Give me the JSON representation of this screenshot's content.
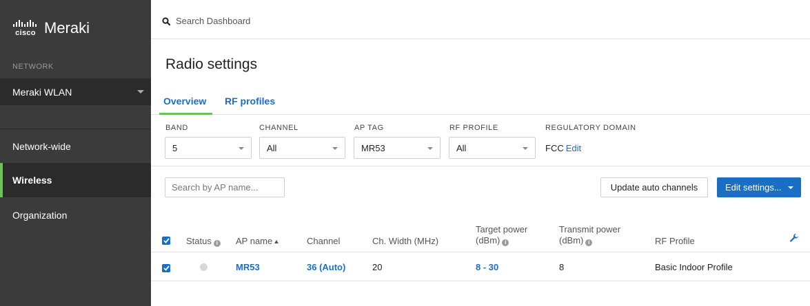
{
  "sidebar": {
    "logo_brand": "cisco",
    "logo_product": "Meraki",
    "section_label": "NETWORK",
    "network_selected": "Meraki WLAN",
    "items": [
      {
        "label": "Network-wide"
      },
      {
        "label": "Wireless"
      },
      {
        "label": "Organization"
      }
    ]
  },
  "topbar": {
    "search_placeholder": "Search Dashboard"
  },
  "page": {
    "title": "Radio settings",
    "tabs": [
      {
        "label": "Overview",
        "active": true
      },
      {
        "label": "RF profiles",
        "active": false
      }
    ]
  },
  "filters": {
    "band": {
      "label": "BAND",
      "value": "5"
    },
    "channel": {
      "label": "CHANNEL",
      "value": "All"
    },
    "ap_tag": {
      "label": "AP TAG",
      "value": "MR53"
    },
    "rf_profile": {
      "label": "RF PROFILE",
      "value": "All"
    },
    "regulatory": {
      "label": "REGULATORY DOMAIN",
      "value": "FCC",
      "edit_label": "Edit"
    }
  },
  "toolbar": {
    "ap_search_placeholder": "Search by AP name...",
    "update_button": "Update auto channels",
    "edit_button": "Edit settings..."
  },
  "table": {
    "columns": {
      "status": "Status",
      "ap_name": "AP name",
      "channel": "Channel",
      "width": "Ch. Width (MHz)",
      "target_power_1": "Target power",
      "target_power_2": "(dBm)",
      "transmit_power_1": "Transmit power",
      "transmit_power_2": "(dBm)",
      "rf_profile": "RF Profile"
    },
    "rows": [
      {
        "ap_name": "MR53",
        "channel": "36 (Auto)",
        "width": "20",
        "target_power": "8 - 30",
        "transmit_power": "8",
        "rf_profile": "Basic Indoor Profile",
        "checked": true
      }
    ]
  },
  "colors": {
    "accent": "#1a6ec4",
    "active_green": "#6ac259",
    "sidebar_bg": "#3b3b3b"
  }
}
